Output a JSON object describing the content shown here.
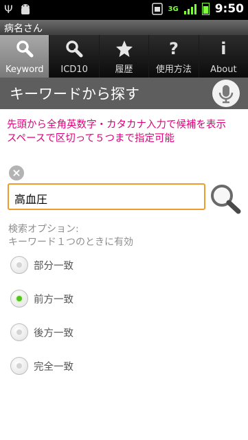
{
  "statusbar": {
    "signal_label": "3G",
    "time": "9:50"
  },
  "app_title": "病名さん",
  "tabs": [
    {
      "label": "Keyword",
      "icon": "search-icon",
      "active": true
    },
    {
      "label": "ICD10",
      "icon": "search-icon",
      "active": false
    },
    {
      "label": "履歴",
      "icon": "star-icon",
      "active": false
    },
    {
      "label": "使用方法",
      "icon": "question-icon",
      "active": false
    },
    {
      "label": "About",
      "icon": "info-icon",
      "active": false
    }
  ],
  "header": {
    "label": "キーワードから探す"
  },
  "instruction": {
    "line1": "先頭から全角英数字・カタカナ入力で候補を表示",
    "line2": "スペースで区切って５つまで指定可能"
  },
  "search": {
    "value": "高血圧"
  },
  "options": {
    "label_line1": "検索オプション:",
    "label_line2": "キーワード１つのときに有効",
    "items": [
      {
        "label": "部分一致",
        "checked": false
      },
      {
        "label": "前方一致",
        "checked": true
      },
      {
        "label": "後方一致",
        "checked": false
      },
      {
        "label": "完全一致",
        "checked": false
      }
    ]
  },
  "colors": {
    "accent_text": "#e0007c",
    "input_border": "#f09a2a",
    "radio_checked": "#52c41a"
  }
}
